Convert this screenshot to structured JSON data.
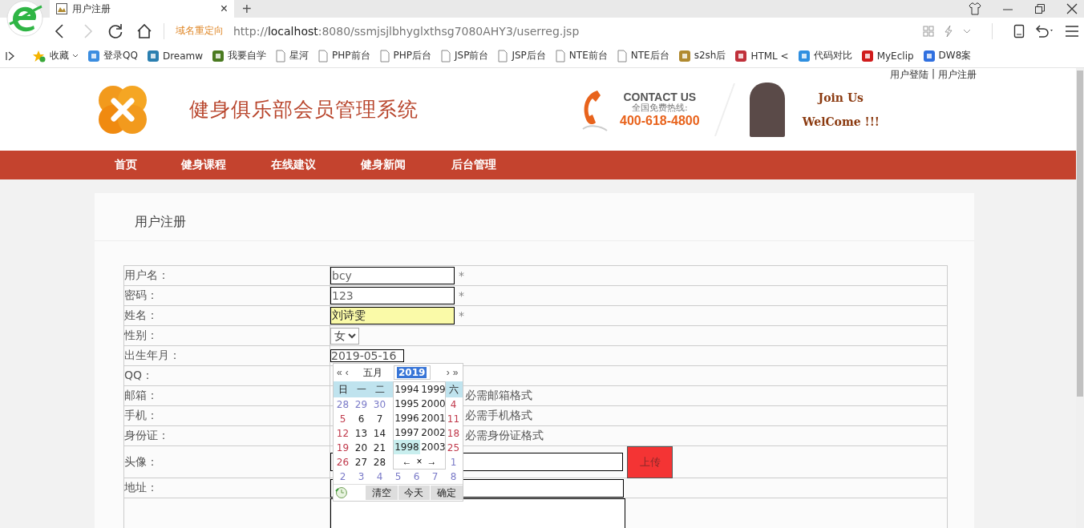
{
  "browser": {
    "tab_title": "用户注册",
    "tab_close": "×",
    "new_tab": "+",
    "redirect_label": "域名重定向",
    "url_scheme": "http://",
    "url_host": "localhost",
    "url_rest": ":8080/ssmjsjlbhyglxthsg7080AHY3/userreg.jsp",
    "bookmarks": [
      {
        "label": "收藏",
        "kind": "star",
        "color": "#f5b400"
      },
      {
        "label": "登录QQ",
        "kind": "app",
        "color": "#3b8de0"
      },
      {
        "label": "Dreamw",
        "kind": "app",
        "color": "#2a7fb0"
      },
      {
        "label": "我要自学",
        "kind": "app",
        "color": "#4a7a20"
      },
      {
        "label": "星河",
        "kind": "page"
      },
      {
        "label": "PHP前台",
        "kind": "page"
      },
      {
        "label": "PHP后台",
        "kind": "page"
      },
      {
        "label": "JSP前台",
        "kind": "page"
      },
      {
        "label": "JSP后台",
        "kind": "page"
      },
      {
        "label": "NTE前台",
        "kind": "page"
      },
      {
        "label": "NTE后台",
        "kind": "page"
      },
      {
        "label": "s2sh后",
        "kind": "app",
        "color": "#b08a30"
      },
      {
        "label": "HTML <",
        "kind": "app",
        "color": "#c0303a"
      },
      {
        "label": "代码对比",
        "kind": "app",
        "color": "#2f8fe0"
      },
      {
        "label": "MyEclip",
        "kind": "app",
        "color": "#d01c1c"
      },
      {
        "label": "DW8案",
        "kind": "app",
        "color": "#3070e0"
      }
    ]
  },
  "header": {
    "auth_links": [
      "用户登陆",
      "用户注册"
    ],
    "auth_separator": "|",
    "site_title": "健身俱乐部会员管理系统",
    "contact_title": "CONTACT US",
    "hotline_label": "全国免费热线:",
    "hotline_number": "400-618-4800",
    "join_text": "Join Us",
    "welcome_text": "WelCome !!!"
  },
  "nav": {
    "items": [
      "首页",
      "健身课程",
      "在线建议",
      "健身新闻",
      "后台管理"
    ]
  },
  "page": {
    "title": "用户注册"
  },
  "form": {
    "required_mark": "*",
    "rows": [
      {
        "label": "用户名：",
        "kind": "text",
        "value": "bcy",
        "required": true,
        "autofilled": false
      },
      {
        "label": "密码：",
        "kind": "text",
        "value": "123",
        "required": true,
        "autofilled": false
      },
      {
        "label": "姓名：",
        "kind": "text",
        "value": "刘诗雯",
        "required": true,
        "autofilled": true
      },
      {
        "label": "性别：",
        "kind": "select",
        "value": "女"
      },
      {
        "label": "出生年月：",
        "kind": "date",
        "value": "2019-05-16"
      },
      {
        "label": "QQ：",
        "kind": "covered"
      },
      {
        "label": "邮箱：",
        "kind": "covered",
        "hint": "必需邮箱格式"
      },
      {
        "label": "手机：",
        "kind": "covered",
        "hint": "必需手机格式"
      },
      {
        "label": "身份证：",
        "kind": "covered",
        "hint": "必需身份证格式"
      },
      {
        "label": "头像：",
        "kind": "file",
        "button": "上传"
      },
      {
        "label": "地址：",
        "kind": "input"
      },
      {
        "kind": "textarea"
      }
    ]
  },
  "date_picker": {
    "nav_prev": [
      "«",
      "‹"
    ],
    "month": "五月",
    "year": {
      "text": "2019",
      "selected": true
    },
    "nav_next": [
      "›",
      "»"
    ],
    "weekdays_left": [
      "日",
      "一",
      "二"
    ],
    "weekdays_right": [
      "六"
    ],
    "weeks": [
      {
        "left": [
          {
            "text": "28",
            "kind": "other"
          },
          {
            "text": "29",
            "kind": "other"
          },
          {
            "text": "30",
            "kind": "other"
          }
        ],
        "right": [
          {
            "text": "4",
            "kind": "weekend"
          }
        ]
      },
      {
        "left": [
          {
            "text": "5",
            "kind": "weekend"
          },
          {
            "text": "6",
            "kind": "normal"
          },
          {
            "text": "7",
            "kind": "normal"
          }
        ],
        "right": [
          {
            "text": "11",
            "kind": "weekend"
          }
        ]
      },
      {
        "left": [
          {
            "text": "12",
            "kind": "weekend"
          },
          {
            "text": "13",
            "kind": "normal"
          },
          {
            "text": "14",
            "kind": "normal"
          }
        ],
        "right": [
          {
            "text": "18",
            "kind": "weekend"
          }
        ]
      },
      {
        "left": [
          {
            "text": "19",
            "kind": "weekend"
          },
          {
            "text": "20",
            "kind": "normal"
          },
          {
            "text": "21",
            "kind": "normal"
          }
        ],
        "right": [
          {
            "text": "25",
            "kind": "weekend"
          }
        ]
      },
      {
        "left": [
          {
            "text": "26",
            "kind": "weekend"
          },
          {
            "text": "27",
            "kind": "normal"
          },
          {
            "text": "28",
            "kind": "normal"
          }
        ],
        "right": [
          {
            "text": "1",
            "kind": "other"
          }
        ]
      },
      {
        "days": [
          {
            "text": "2",
            "kind": "other"
          },
          {
            "text": "3",
            "kind": "other"
          },
          {
            "text": "4",
            "kind": "other"
          },
          {
            "text": "5",
            "kind": "other"
          },
          {
            "text": "6",
            "kind": "other"
          },
          {
            "text": "7",
            "kind": "other"
          },
          {
            "text": "8",
            "kind": "other"
          }
        ]
      }
    ],
    "years": [
      {
        "text": "1994",
        "selected": false
      },
      {
        "text": "1999",
        "selected": false
      },
      {
        "text": "1995",
        "selected": false
      },
      {
        "text": "2000",
        "selected": false
      },
      {
        "text": "1996",
        "selected": false
      },
      {
        "text": "2001",
        "selected": false
      },
      {
        "text": "1997",
        "selected": false
      },
      {
        "text": "2002",
        "selected": false
      },
      {
        "text": "1998",
        "selected": true
      },
      {
        "text": "2003",
        "selected": false
      }
    ],
    "year_nav": [
      "←",
      "×",
      "→"
    ],
    "buttons": [
      "清空",
      "今天",
      "确定"
    ]
  }
}
